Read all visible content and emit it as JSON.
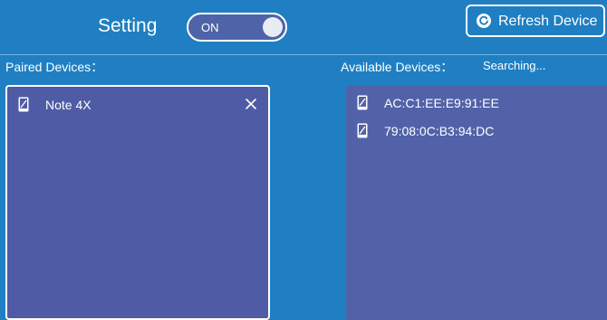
{
  "header": {
    "setting_label": "Setting",
    "toggle_state": "ON",
    "refresh_label": "Refresh Device"
  },
  "paired": {
    "label": "Paired Devices：",
    "devices": [
      {
        "name": "Note 4X",
        "icon": "phone-icon",
        "removable": true
      }
    ]
  },
  "available": {
    "label": "Available Devices：",
    "status": "Searching...",
    "devices": [
      {
        "name": "AC:C1:EE:E9:91:EE",
        "icon": "phone-icon"
      },
      {
        "name": "79:08:0C:B3:94:DC",
        "icon": "phone-icon"
      }
    ]
  },
  "colors": {
    "background": "#1f7fc2",
    "panel": "#4f5ba4",
    "text": "#ffffff"
  }
}
